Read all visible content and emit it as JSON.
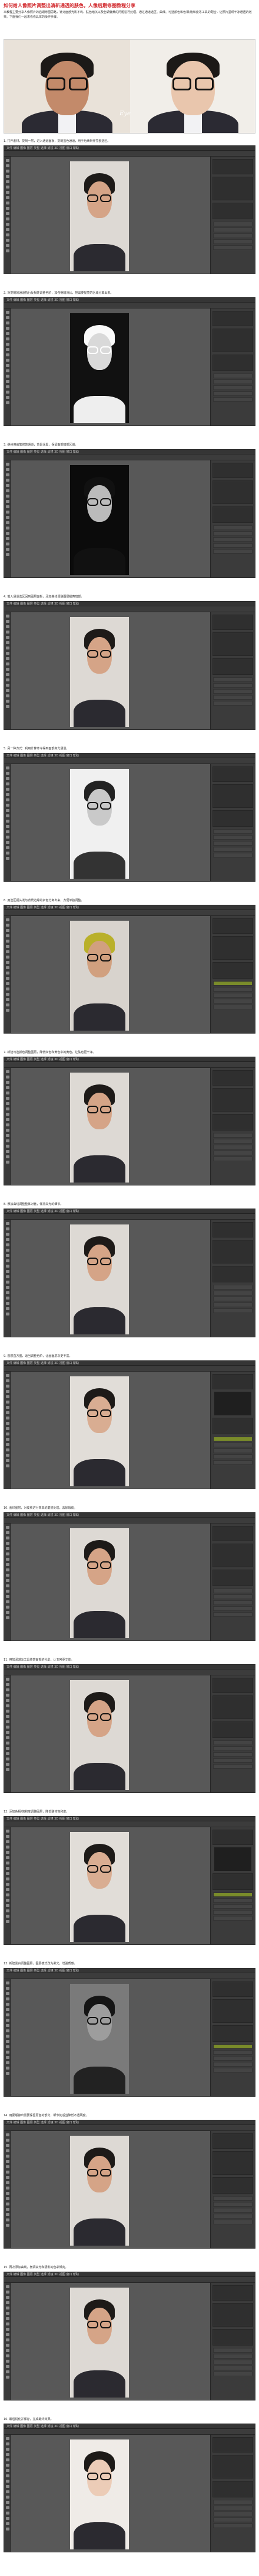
{
  "article": {
    "title": "如何给人像照片调整出清新通透的肤色，人像后期修图教程分享",
    "intro": "本教程主要分享人像照片的后期修图思路，针对面部光影不均、肤色暗沉以及色调偏黄的问题进行处理，通过通道选区、曲线、可选颜色和色相/饱和度等工具的配合，让照片呈现干净通透的效果。下面我们一起来看看具体的操作步骤。"
  },
  "before_after": {
    "signature": "Eye"
  },
  "steps": [
    {
      "caption": "1. 打开素材，复制一层，进入通道面板，复制蓝色通道，用于后续制作亮部选区。",
      "mode": "color"
    },
    {
      "caption": "2. 对复制的通道执行反相并调整色阶，加强明暗对比，把需要提亮的区域分离出来。",
      "mode": "inverted"
    },
    {
      "caption": "3. 继续用画笔修饰通道，背景涂黑，保留面部暗部区域。",
      "mode": "dark"
    },
    {
      "caption": "4. 载入通道选区回到图层面板，添加曲线调整图层提亮暗部。",
      "mode": "color"
    },
    {
      "caption": "5. 另一种方式：利用计算命令得到面部高光通道。",
      "mode": "gray"
    },
    {
      "caption": "6. 用选区把头发与背景边缘的杂色分离出来，方便单独调整。",
      "mode": "yellowhair"
    },
    {
      "caption": "7. 新建可选颜色调整图层，降低红色和黄色中的黄色，让肤色更干净。",
      "mode": "color"
    },
    {
      "caption": "8. 添加曲线调整整体对比，保持高光的细节。",
      "mode": "color"
    },
    {
      "caption": "9. 观察直方图，适当调整色阶，让画面层次更丰富。",
      "mode": "hist"
    },
    {
      "caption": "10. 盖印图层，对皮肤进行简单的磨皮处理，去除瑕疵。",
      "mode": "color"
    },
    {
      "caption": "11. 用加深减淡工具修饰面部的光影，让五官更立体。",
      "mode": "color"
    },
    {
      "caption": "12. 添加色相/饱和度调整图层，降低整体饱和度。",
      "mode": "hist"
    },
    {
      "caption": "13. 新建黑白调整图层，图层模式改为柔光，增强质感。",
      "mode": "bw"
    },
    {
      "caption": "14. 用蒙版擦出需要保留原色的部分，细节处适当降低不透明度。",
      "mode": "color"
    },
    {
      "caption": "15. 再次添加曲线，微调高光和阴影的色彩倾向。",
      "mode": "color"
    },
    {
      "caption": "16. 最后锐化并保存，完成最终效果。",
      "mode": "final"
    }
  ],
  "ps": {
    "menu": "文件 编辑 图像 图层 类型 选择 滤镜 3D 视图 窗口 帮助"
  }
}
